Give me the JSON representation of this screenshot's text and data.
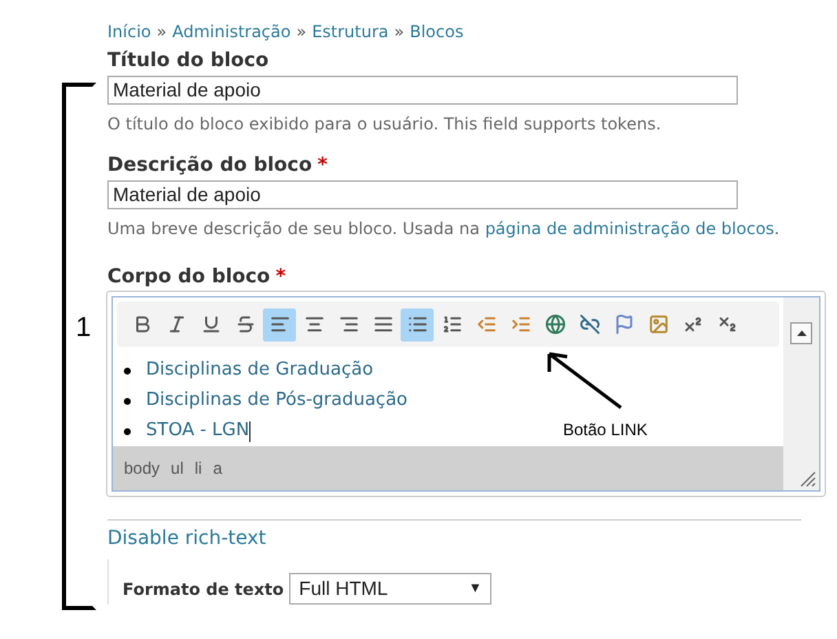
{
  "breadcrumb": [
    "Início",
    "Administração",
    "Estrutura",
    "Blocos"
  ],
  "breadcrumb_separator": "»",
  "title_field": {
    "label": "Título do bloco",
    "value": "Material de apoio",
    "help": "O título do bloco exibido para o usuário. This field supports tokens."
  },
  "description_field": {
    "label": "Descrição do bloco",
    "required_mark": "*",
    "value": "Material de apoio",
    "help": "Uma breve descrição de seu bloco. Usada na ",
    "help_link": "página de administração de blocos",
    "help_end": "."
  },
  "body_field": {
    "label": "Corpo do bloco",
    "required_mark": "*",
    "toolbar": [
      {
        "kind": "bold",
        "selected": false
      },
      {
        "kind": "italic",
        "selected": false
      },
      {
        "kind": "underline",
        "selected": false
      },
      {
        "kind": "strike",
        "selected": false
      },
      {
        "kind": "align-left",
        "selected": true
      },
      {
        "kind": "align-center",
        "selected": false
      },
      {
        "kind": "align-right",
        "selected": false
      },
      {
        "kind": "justify",
        "selected": false
      },
      {
        "kind": "bullets",
        "selected": true
      },
      {
        "kind": "numbers",
        "selected": false
      },
      {
        "kind": "outdent",
        "selected": false
      },
      {
        "kind": "indent",
        "selected": false
      },
      {
        "kind": "link",
        "selected": false
      },
      {
        "kind": "unlink",
        "selected": false
      },
      {
        "kind": "anchor",
        "selected": false
      },
      {
        "kind": "image",
        "selected": false
      },
      {
        "kind": "superscript",
        "selected": false
      },
      {
        "kind": "subscript",
        "selected": false
      }
    ],
    "content": [
      "Disciplinas de Graduação",
      "Disciplinas de Pós-graduação",
      "STOA - LGN"
    ],
    "path": [
      "body",
      "ul",
      "li",
      "a"
    ]
  },
  "toggle_link": "Disable rich-text",
  "format": {
    "label": "Formato de texto",
    "value": "Full HTML",
    "caret": "▼"
  },
  "annotation": {
    "number": "1",
    "arrow_label": "Botão LINK"
  }
}
